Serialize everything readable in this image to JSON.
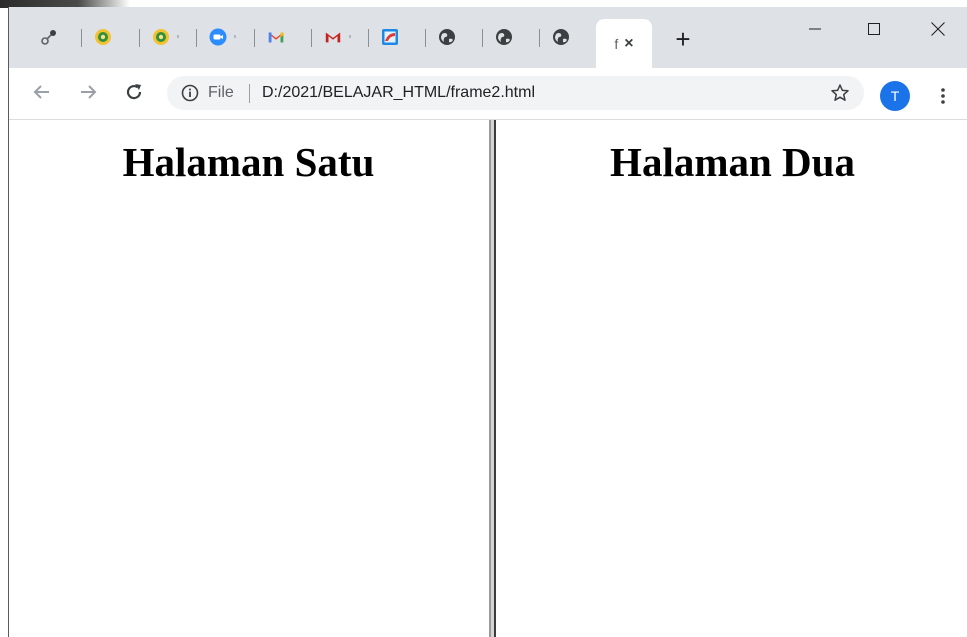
{
  "browser": {
    "tabs": [
      {
        "icon": "extension-link-icon"
      },
      {
        "icon": "emblem-icon"
      },
      {
        "icon": "emblem-icon"
      },
      {
        "icon": "zoom-icon"
      },
      {
        "icon": "gmail-icon"
      },
      {
        "icon": "gmail-icon"
      },
      {
        "icon": "blue-app-icon"
      },
      {
        "icon": "globe-icon"
      },
      {
        "icon": "globe-icon"
      },
      {
        "icon": "globe-icon"
      }
    ],
    "active_tab": {
      "title": "f",
      "close": "×"
    },
    "new_tab_label": "+",
    "address": {
      "scheme": "File",
      "url": "D:/2021/BELAJAR_HTML/frame2.html"
    },
    "profile_initial": "T"
  },
  "frames": {
    "left_heading": "Halaman Satu",
    "right_heading": "Halaman Dua"
  },
  "colors": {
    "tabstrip": "#dee1e6",
    "omnibox": "#f1f3f4",
    "avatar": "#1a73e8"
  }
}
